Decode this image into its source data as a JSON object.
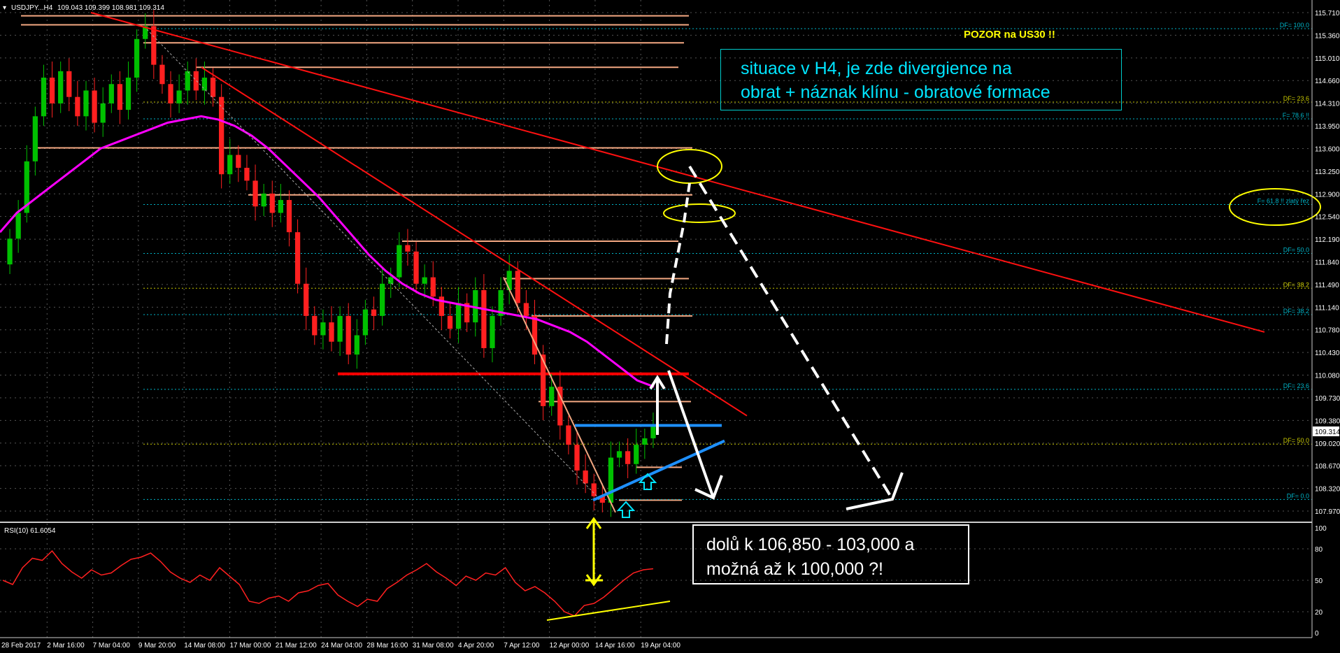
{
  "header": {
    "symbol": "USDJPY...H4",
    "ohlc": "109.043 109.399 108.981 109.314"
  },
  "rsi_label": "RSI(10) 61.6054",
  "warning": "POZOR na US30 !!",
  "note_top": {
    "line1": "situace v H4, je zde divergience na",
    "line2": "obrat + náznak klínu - obratové formace"
  },
  "note_bottom": {
    "line1": "dolů k 106,850 - 103,000 a",
    "line2": "možná až k 100,000 ?!"
  },
  "colors": {
    "bull": "#00c000",
    "bear": "#ff2020",
    "ma": "#ff00ff",
    "trend": "#ff1010",
    "level": "#f4a882",
    "wedge": "#1e90ff",
    "fib_cyan": "#00b4c8",
    "fib_yellow": "#c8c800",
    "annot": "#ffff00"
  },
  "chart_data": {
    "type": "candlestick",
    "title": "USDJPY...H4",
    "y_ticks": [
      "115.710",
      "115.360",
      "115.010",
      "114.660",
      "114.310",
      "113.950",
      "113.600",
      "113.250",
      "112.900",
      "112.540",
      "112.190",
      "111.840",
      "111.490",
      "111.140",
      "110.780",
      "110.430",
      "110.080",
      "109.730",
      "109.380",
      "109.020",
      "108.670",
      "108.320",
      "107.970"
    ],
    "x_ticks": [
      "28 Feb 2017",
      "2 Mar 16:00",
      "7 Mar 04:00",
      "9 Mar 20:00",
      "14 Mar 08:00",
      "17 Mar 00:00",
      "21 Mar 12:00",
      "24 Mar 04:00",
      "28 Mar 16:00",
      "31 Mar 08:00",
      "4 Apr 20:00",
      "7 Apr 12:00",
      "12 Apr 00:00",
      "14 Apr 16:00",
      "19 Apr 04:00"
    ],
    "ylim": [
      107.92,
      115.81
    ],
    "last_price": "109.314",
    "closes": [
      112.2,
      112.6,
      113.4,
      114.1,
      114.7,
      114.3,
      114.8,
      114.4,
      114.1,
      114.5,
      114.0,
      114.3,
      114.6,
      114.2,
      114.7,
      115.3,
      115.5,
      114.9,
      114.6,
      114.3,
      114.5,
      114.8,
      114.5,
      114.7,
      114.4,
      113.2,
      113.5,
      113.3,
      113.1,
      112.7,
      112.9,
      112.6,
      112.8,
      112.3,
      111.5,
      111.0,
      110.7,
      110.9,
      110.6,
      111.0,
      110.4,
      110.7,
      111.1,
      111.0,
      111.5,
      111.6,
      112.1,
      112.0,
      111.5,
      111.6,
      111.3,
      111.0,
      110.8,
      111.2,
      110.9,
      111.4,
      110.5,
      111.0,
      111.4,
      111.7,
      111.2,
      111.0,
      110.4,
      109.6,
      109.9,
      109.3,
      109.0,
      108.6,
      108.4,
      108.2,
      108.1,
      108.8,
      108.9,
      108.7,
      109.0,
      109.1,
      109.3
    ],
    "ma": [
      112.3,
      112.6,
      112.8,
      113.0,
      113.2,
      113.4,
      113.6,
      113.7,
      113.8,
      113.9,
      114.0,
      114.05,
      114.1,
      114.05,
      113.95,
      113.8,
      113.6,
      113.35,
      113.1,
      112.85,
      112.55,
      112.25,
      111.95,
      111.7,
      111.5,
      111.35,
      111.25,
      111.2,
      111.15,
      111.1,
      111.05,
      111.0,
      110.95,
      110.85,
      110.75,
      110.6,
      110.4,
      110.2,
      110.0,
      109.9
    ],
    "rsi": [
      50,
      46,
      62,
      71,
      69,
      78,
      66,
      58,
      52,
      60,
      55,
      57,
      64,
      70,
      72,
      76,
      68,
      58,
      52,
      48,
      55,
      50,
      62,
      54,
      46,
      30,
      28,
      33,
      35,
      30,
      38,
      40,
      45,
      47,
      36,
      30,
      25,
      32,
      30,
      42,
      48,
      55,
      60,
      66,
      58,
      52,
      45,
      54,
      50,
      57,
      55,
      62,
      48,
      40,
      44,
      38,
      30,
      20,
      16,
      26,
      28,
      34,
      42,
      50,
      57,
      60,
      61
    ],
    "rsi_levels": [
      100,
      80,
      50,
      20,
      0
    ],
    "fib_labels": [
      {
        "text": "DF= 100.0",
        "price": 115.46,
        "color": "#00b4c8"
      },
      {
        "text": "DF= 23.6",
        "price": 114.32,
        "color": "#c8c800"
      },
      {
        "text": "F= 78.6 !!",
        "price": 114.06,
        "color": "#00b4c8"
      },
      {
        "text": "F= 61.8 !! zlatý řez",
        "price": 112.73,
        "color": "#00b4c8"
      },
      {
        "text": "DF= 50.0",
        "price": 111.97,
        "color": "#00b4c8"
      },
      {
        "text": "DF= 38.2",
        "price": 111.43,
        "color": "#c8c800"
      },
      {
        "text": "DF= 38.2",
        "price": 111.02,
        "color": "#00b4c8"
      },
      {
        "text": "DF= 23.6",
        "price": 109.86,
        "color": "#00b4c8"
      },
      {
        "text": "DF= 50.0",
        "price": 109.01,
        "color": "#c8c800"
      },
      {
        "text": "DF= 0.0",
        "price": 108.15,
        "color": "#00b4c8"
      }
    ],
    "levels": [
      115.66,
      115.52,
      115.24,
      114.86,
      113.61,
      112.88,
      112.16,
      111.58,
      111.0,
      109.67,
      108.65,
      108.14
    ],
    "support_red": 110.1,
    "wedge_top": 109.3
  }
}
